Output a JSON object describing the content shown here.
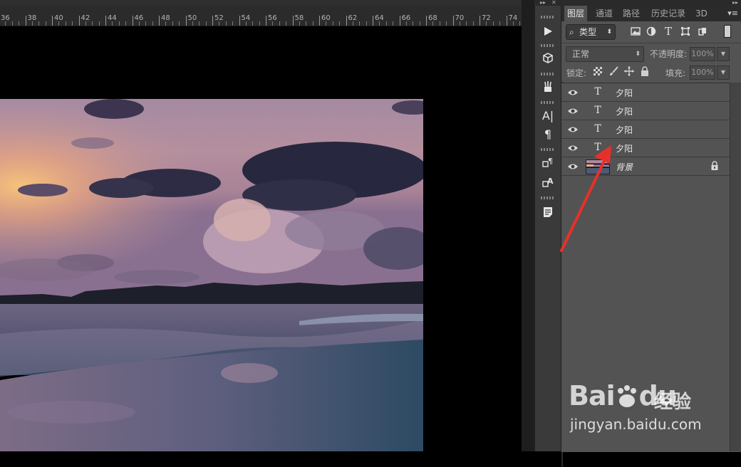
{
  "ruler": {
    "labels": [
      "36",
      "38",
      "40",
      "42",
      "44",
      "46",
      "48",
      "50",
      "52",
      "54",
      "56",
      "58",
      "60",
      "62",
      "64",
      "66",
      "68",
      "70",
      "72",
      "74"
    ]
  },
  "dock": {
    "collapse_label": "▸▸",
    "close_label": "✕"
  },
  "panel": {
    "tabs": [
      {
        "label": "图层",
        "active": true
      },
      {
        "label": "通道",
        "active": false
      },
      {
        "label": "路径",
        "active": false
      },
      {
        "label": "历史记录",
        "active": false
      },
      {
        "label": "3D",
        "active": false
      }
    ],
    "menu_icon": "▾≡",
    "filter": {
      "selected": "类型",
      "icons": [
        "image-filter-icon",
        "adjustment-filter-icon",
        "type-filter-icon",
        "shape-filter-icon",
        "smart-object-filter-icon"
      ]
    },
    "blend_mode": "正常",
    "opacity_label": "不透明度:",
    "opacity_value": "100%",
    "lock_label": "锁定:",
    "fill_label": "填充:",
    "fill_value": "100%"
  },
  "layers": [
    {
      "type": "text",
      "thumb": "T",
      "name": "夕阳"
    },
    {
      "type": "text",
      "thumb": "T",
      "name": "夕阳"
    },
    {
      "type": "text",
      "thumb": "T",
      "name": "夕阳"
    },
    {
      "type": "text",
      "thumb": "T",
      "name": "夕阳"
    },
    {
      "type": "image",
      "name": "背景",
      "locked": true
    }
  ],
  "tools": [
    "play-icon",
    "3d-icon",
    "brush-presets-icon",
    "character-icon",
    "paragraph-icon",
    "paragraph-styles-icon",
    "character-styles-icon",
    "notes-icon"
  ],
  "tool_glyphs": {
    "character": "A|",
    "paragraph": "¶"
  },
  "watermark": {
    "brand": "Bai",
    "brand2": "du",
    "cn": "经验",
    "url": "jingyan.baidu.com"
  },
  "colors": {
    "panel_bg": "#535353",
    "tab_bar": "#2b2b2b",
    "toolstrip": "#3a3a3a",
    "arrow": "#e8302a"
  }
}
